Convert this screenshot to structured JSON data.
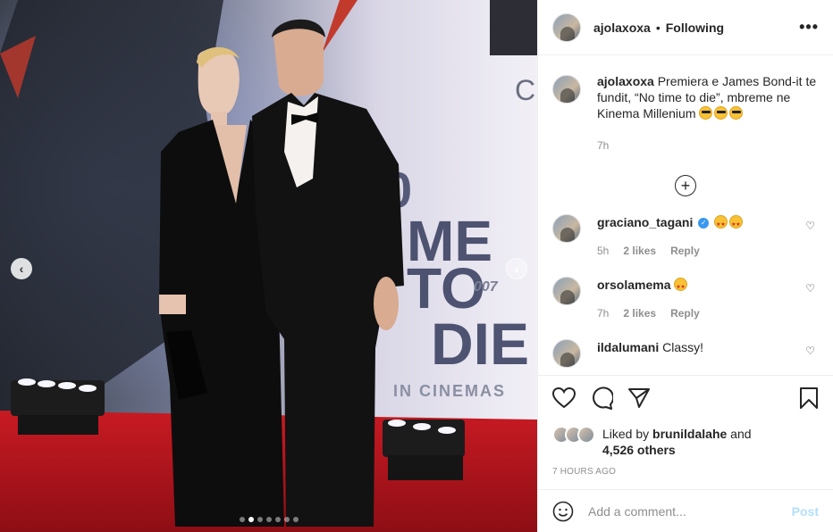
{
  "colors": {
    "accent": "#0095f6",
    "post_disabled": "#b2dffc",
    "muted": "#8e8e8e",
    "text": "#262626",
    "carpet": "#b3141d"
  },
  "photo": {
    "poster_text_line1": "ME",
    "poster_text_line2": "TO",
    "poster_text_line3": "DIE",
    "poster_brand": "007",
    "poster_cinemas": "IN CINEMAS",
    "poster_top_letter": "C",
    "carousel": {
      "total": 7,
      "active_index": 1
    },
    "prev_icon": "chevron-left-icon",
    "next_icon": "chevron-right-icon"
  },
  "header": {
    "username": "ajolaxoxa",
    "separator": "•",
    "follow_status": "Following",
    "more_icon": "more-options-icon"
  },
  "caption": {
    "username": "ajolaxoxa",
    "text": "Premiera e James Bond-it te fundit, “No time to die”, mbreme ne Kinema Millenium",
    "emojis": [
      "sunglasses",
      "sunglasses",
      "sunglasses"
    ],
    "time": "7h"
  },
  "load_more_icon": "plus-circle-icon",
  "comments": [
    {
      "username": "graciano_tagani",
      "verified": true,
      "text": "",
      "emojis": [
        "starstruck",
        "starstruck"
      ],
      "time": "5h",
      "likes": "2 likes",
      "reply": "Reply"
    },
    {
      "username": "orsolamema",
      "verified": false,
      "text": "",
      "emojis": [
        "starstruck"
      ],
      "time": "7h",
      "likes": "2 likes",
      "reply": "Reply"
    },
    {
      "username": "ildalumani",
      "verified": false,
      "text": "Classy!",
      "emojis": [],
      "time": "",
      "likes": "",
      "reply": ""
    }
  ],
  "liked_by": {
    "prefix": "Liked by",
    "user": "brunildalahe",
    "and": "and",
    "others": "4,526 others"
  },
  "post_time": "7 HOURS AGO",
  "add_comment": {
    "placeholder": "Add a comment...",
    "post_label": "Post"
  }
}
